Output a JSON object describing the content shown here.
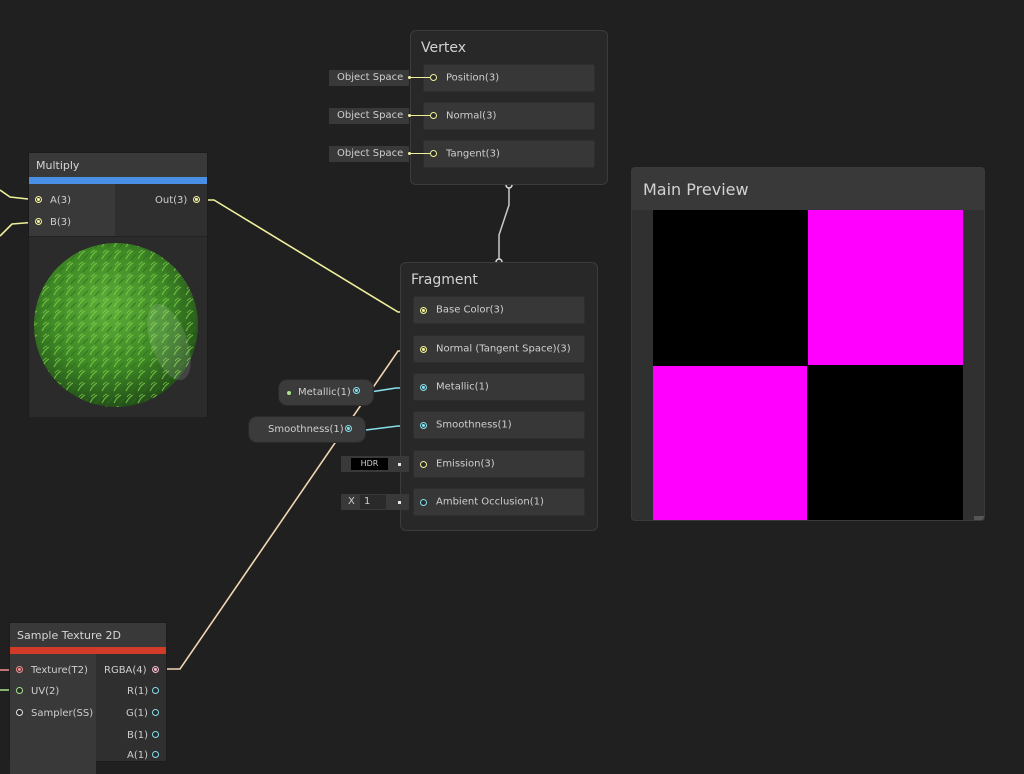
{
  "vertex": {
    "title": "Vertex",
    "ports": [
      {
        "label": "Position(3)",
        "input": "Object Space"
      },
      {
        "label": "Normal(3)",
        "input": "Object Space"
      },
      {
        "label": "Tangent(3)",
        "input": "Object Space"
      }
    ]
  },
  "fragment": {
    "title": "Fragment",
    "ports": [
      {
        "label": "Base Color(3)"
      },
      {
        "label": "Normal (Tangent Space)(3)"
      },
      {
        "label": "Metallic(1)"
      },
      {
        "label": "Smoothness(1)"
      },
      {
        "label": "Emission(3)"
      },
      {
        "label": "Ambient Occlusion(1)"
      }
    ],
    "emission_input": "HDR",
    "ao_input": {
      "axis": "X",
      "value": "1"
    }
  },
  "property_pills": {
    "metallic": "Metallic(1)",
    "smoothness": "Smoothness(1)"
  },
  "multiply_node": {
    "title": "Multiply",
    "header_color": "#4a8fe6",
    "inputs": [
      "A(3)",
      "B(3)"
    ],
    "output": "Out(3)"
  },
  "sample_texture_node": {
    "title": "Sample Texture 2D",
    "header_color": "#d23a2a",
    "inputs": [
      "Texture(T2)",
      "UV(2)",
      "Sampler(SS)"
    ],
    "outputs": [
      "RGBA(4)",
      "R(1)",
      "G(1)",
      "B(1)",
      "A(1)"
    ]
  },
  "main_preview": {
    "title": "Main Preview",
    "colors": {
      "magenta": "#ff00ff",
      "black": "#000000"
    }
  }
}
